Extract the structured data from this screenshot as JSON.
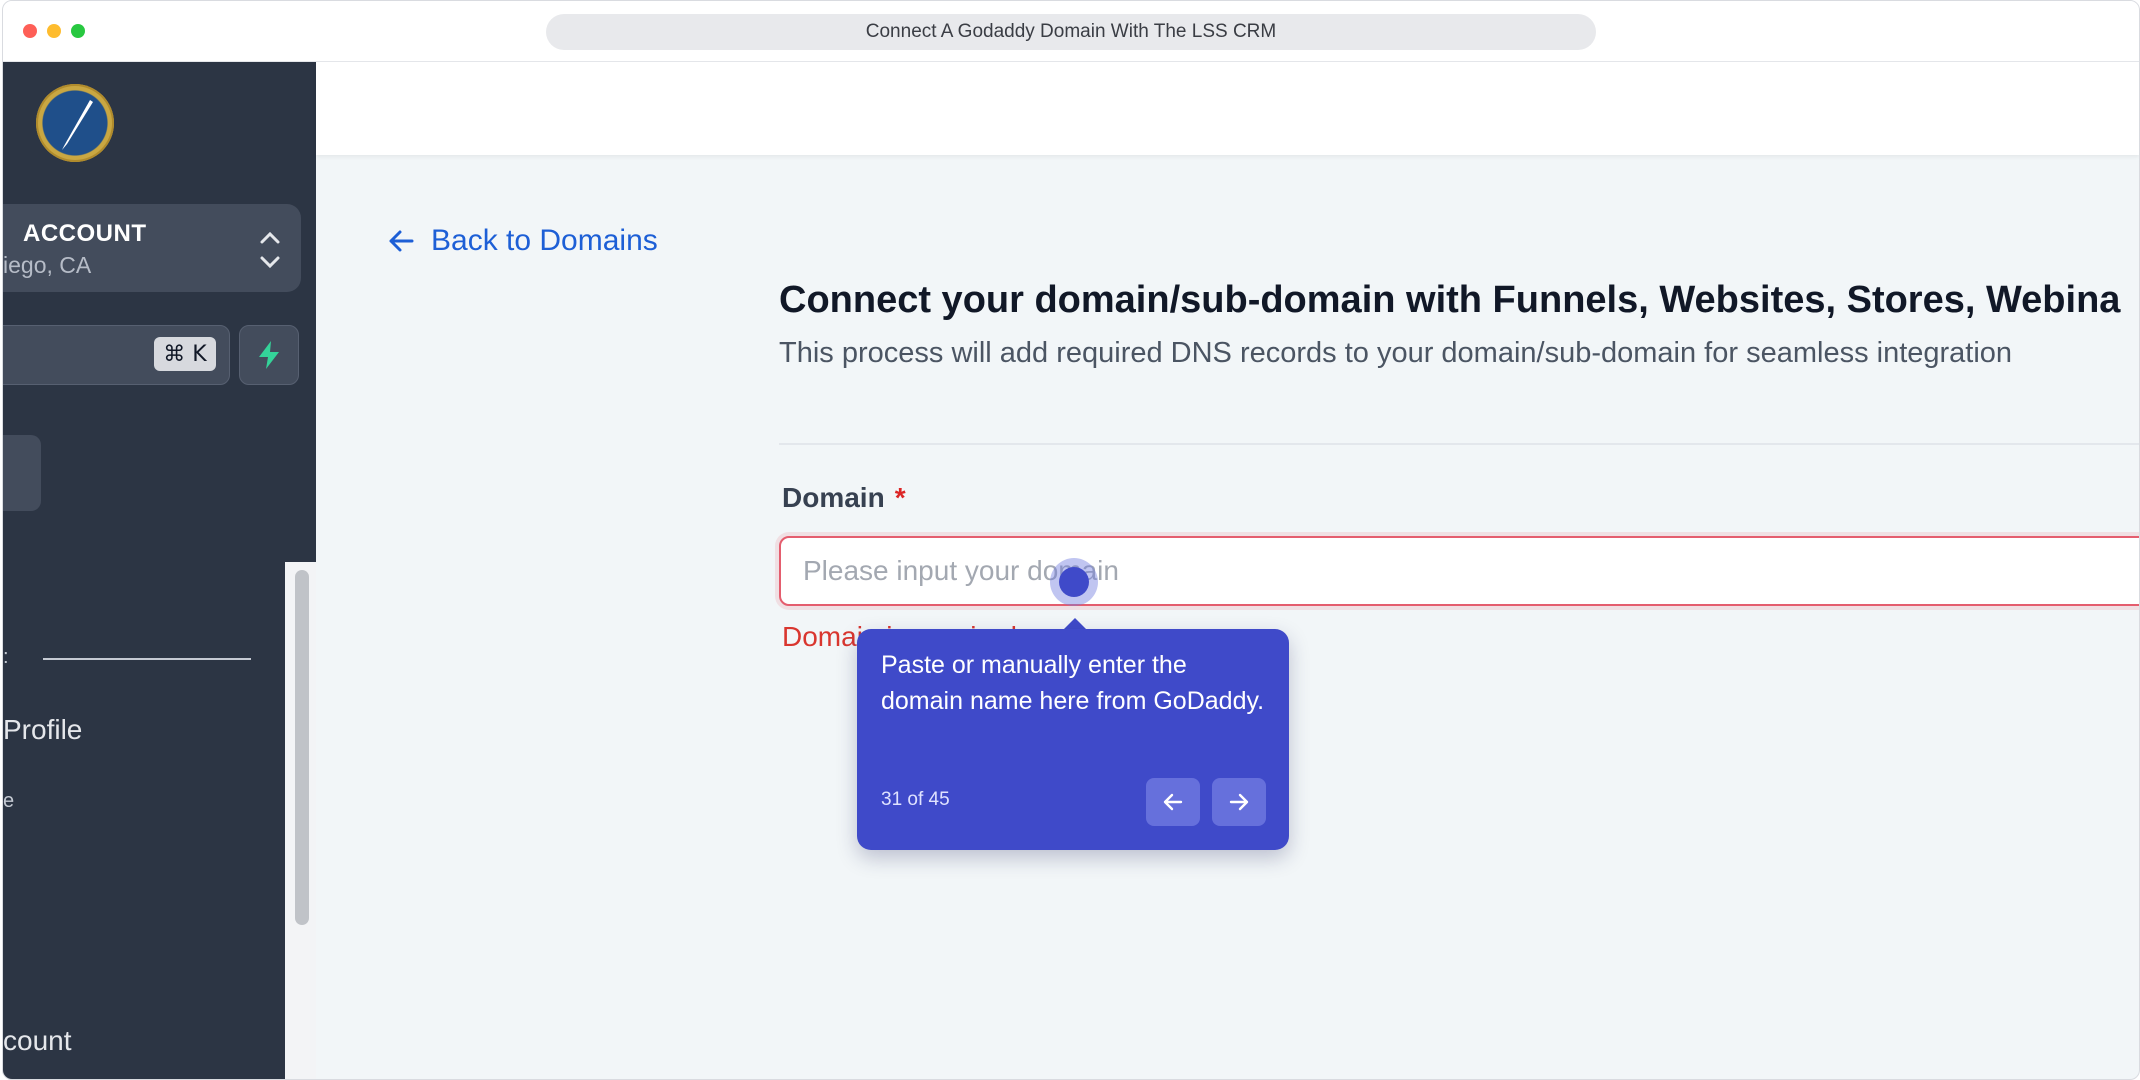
{
  "window": {
    "url_title": "Connect A Godaddy Domain With The LSS CRM"
  },
  "sidebar": {
    "account_name": "ACCOUNT",
    "account_location": "iego, CA",
    "search_shortcut": "⌘ K",
    "items": [
      {
        "label": "Profile"
      },
      {
        "label": "count"
      }
    ],
    "dots": [
      ":",
      "e"
    ]
  },
  "main": {
    "back_link": "Back to Domains",
    "heading": "Connect your domain/sub-domain with Funnels, Websites, Stores, Webina",
    "subheading": "This process will add required DNS records to your domain/sub-domain for seamless integration",
    "domain_label": "Domain",
    "required_mark": "*",
    "domain_placeholder": "Please input your domain",
    "domain_value": "",
    "error_text": "Domain is required"
  },
  "tour": {
    "text": "Paste or manually enter the domain name here from GoDaddy.",
    "step_count": "31 of 45"
  },
  "colors": {
    "sidebar_bg": "#2c3544",
    "accent_blue": "#1d5fd6",
    "tour_bg": "#3f4ac9",
    "error_red": "#d9362f"
  }
}
